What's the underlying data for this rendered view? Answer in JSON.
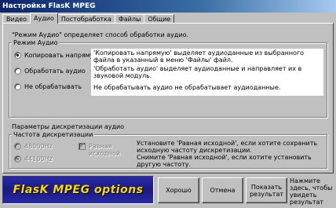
{
  "window": {
    "title": "Настройки FlasK MPEG"
  },
  "tabs": [
    {
      "label": "Видео"
    },
    {
      "label": "Аудио"
    },
    {
      "label": "Постобработка"
    },
    {
      "label": "Файлы"
    },
    {
      "label": "Общие"
    }
  ],
  "intro": "\"Режим Аудио\" определяет способ обработки аудио.",
  "audio_mode": {
    "legend": "Режим Аудио",
    "options": [
      {
        "label": "Копировать напрямую",
        "desc": "'Копировать напрямую' выделяет аудиоданные из выбранного файла в указанный в меню 'Файлы' файл.",
        "checked": true
      },
      {
        "label": "Обработать аудио",
        "desc": "'Обработать аудио' выделяет аудиоданные и направляет их в звуковой модуль.",
        "checked": false
      },
      {
        "label": "Не обрабатывать",
        "desc": "Не обрабатывать аудио не обрабатывает аудиоданные.",
        "checked": false
      }
    ]
  },
  "sampling": {
    "section_label": "Параметры дискретизации аудио",
    "legend": "Частота дискретизации",
    "rates": [
      "48000Hz",
      "44100Hz"
    ],
    "equal_label": "Равная исходной",
    "help": "Установите 'Равная исходной', если хотите сохранить исходную частоту дискретизации.\nСнимите 'Равная исходной', если хотите установить другую частоту."
  },
  "logo": {
    "text": "FlasK MPEG options"
  },
  "buttons": {
    "ok": "Хорошо",
    "cancel": "Отмена",
    "show_result": "Показать результат"
  },
  "hint": "Нажмите здесь, чтобы увидеть результат"
}
